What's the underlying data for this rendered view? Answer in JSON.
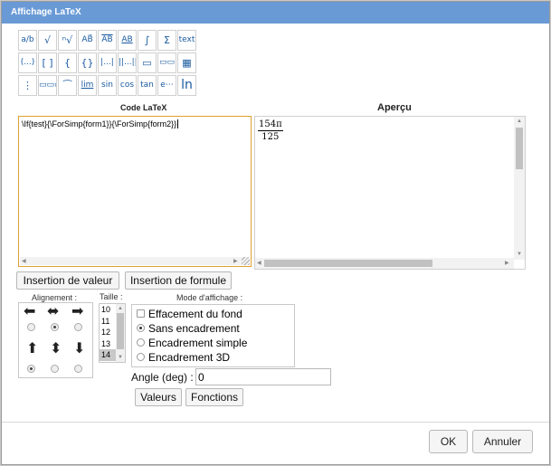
{
  "dialog": {
    "title": "Affichage LaTeX"
  },
  "palette": {
    "row1": [
      "a/b",
      "√",
      "ⁿ√",
      "AB⃗",
      "AB",
      "AB",
      "∫",
      "Σ",
      "text"
    ],
    "row2": [
      "(...)",
      "[ ]",
      "{",
      "{}",
      "|...|",
      "||...||",
      "▭",
      "▭▭",
      "▦"
    ],
    "row3": [
      "⋮",
      "▭▭▭",
      "⁀",
      "lim",
      "sin",
      "cos",
      "tan",
      "e⋯",
      "ln"
    ]
  },
  "code": {
    "label": "Code LaTeX",
    "value": "\\If{test}{\\ForSimp{form1}}{\\ForSimp{form2}}"
  },
  "preview": {
    "label": "Aperçu",
    "numerator": "154π",
    "denominator": "125"
  },
  "buttons": {
    "insert_value": "Insertion de valeur",
    "insert_formula": "Insertion de formule",
    "values": "Valeurs",
    "functions": "Fonctions",
    "ok": "OK",
    "cancel": "Annuler"
  },
  "alignment": {
    "label": "Alignement :",
    "selected_horizontal": "center",
    "selected_vertical": "top"
  },
  "size": {
    "label": "Taille :",
    "options": [
      "10",
      "11",
      "12",
      "13",
      "14"
    ],
    "selected": "14"
  },
  "display_mode": {
    "label": "Mode d'affichage :",
    "erase_background": {
      "label": "Effacement du fond",
      "checked": false
    },
    "options": [
      "Sans encadrement",
      "Encadrement simple",
      "Encadrement 3D"
    ],
    "selected": "Sans encadrement"
  },
  "angle": {
    "label": "Angle (deg) :",
    "value": "0"
  }
}
